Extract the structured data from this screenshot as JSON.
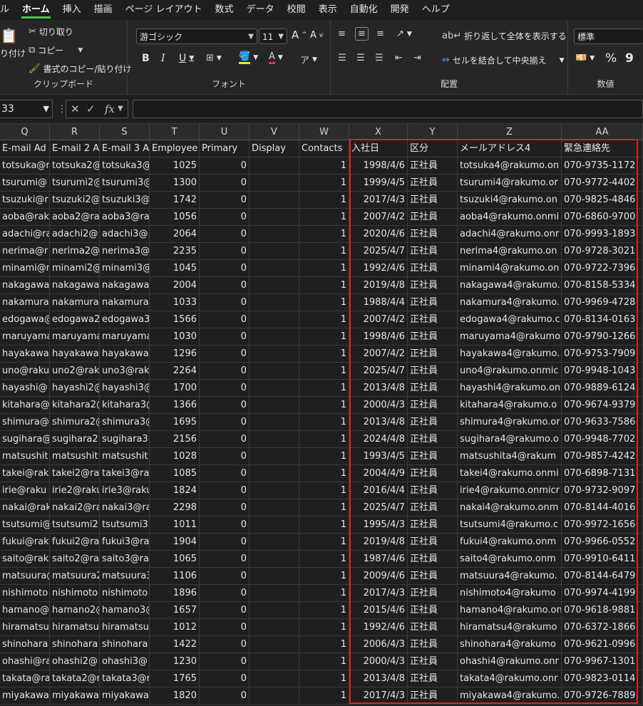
{
  "menu": [
    "ル",
    "ホーム",
    "挿入",
    "描画",
    "ページ レイアウト",
    "数式",
    "データ",
    "校閲",
    "表示",
    "自動化",
    "開発",
    "ヘルプ"
  ],
  "ribbon": {
    "clipboard": {
      "paste": "り付け",
      "cut": "切り取り",
      "copy": "コピー",
      "format_painter": "書式のコピー/貼り付け",
      "label": "クリップボード"
    },
    "font": {
      "family": "游ゴシック",
      "size": "11",
      "grow": "A",
      "shrink": "A",
      "bold": "B",
      "italic": "I",
      "underline": "U",
      "label": "フォント"
    },
    "alignment": {
      "wrap": "折り返して全体を表示する",
      "merge": "セルを結合して中央揃え",
      "label": "配置"
    },
    "number": {
      "format": "標準",
      "percent": "%",
      "comma": "9",
      "label": "数値"
    }
  },
  "formula": {
    "namebox": "33",
    "fx": "fx"
  },
  "columns": [
    "Q",
    "R",
    "S",
    "T",
    "U",
    "V",
    "W",
    "X",
    "Y",
    "Z",
    "AA"
  ],
  "headers": [
    "E-mail Ad",
    "E-mail 2 A",
    "E-mail 3 A",
    "Employee",
    "Primary",
    "Display",
    "Contacts",
    "入社日",
    "区分",
    "メールアドレス4",
    "緊急連絡先"
  ],
  "rows": [
    [
      "totsuka@r",
      "totsuka2@",
      "totsuka3@",
      "1025",
      "0",
      "",
      "1",
      "1998/4/6",
      "正社員",
      "totsuka4@rakumo.on",
      "070-9735-1172"
    ],
    [
      "tsurumi@",
      "tsurumi2@",
      "tsurumi3@",
      "1300",
      "0",
      "",
      "1",
      "1999/4/5",
      "正社員",
      "tsurumi4@rakumo.or",
      "070-9772-4402"
    ],
    [
      "tsuzuki@r",
      "tsuzuki2@",
      "tsuzuki3@",
      "1742",
      "0",
      "",
      "1",
      "2017/4/3",
      "正社員",
      "tsuzuki4@rakumo.on",
      "070-9825-4846"
    ],
    [
      "aoba@rak",
      "aoba2@ra",
      "aoba3@ra",
      "1056",
      "0",
      "",
      "1",
      "2007/4/2",
      "正社員",
      "aoba4@rakumo.onmi",
      "070-6860-9700"
    ],
    [
      "adachi@ra",
      "adachi2@",
      "adachi3@",
      "2064",
      "0",
      "",
      "1",
      "2020/4/6",
      "正社員",
      "adachi4@rakumo.onr",
      "070-9993-1893"
    ],
    [
      "nerima@r",
      "nerima2@",
      "nerima3@",
      "2235",
      "0",
      "",
      "1",
      "2025/4/7",
      "正社員",
      "nerima4@rakumo.on",
      "070-9728-3021"
    ],
    [
      "minami@r",
      "minami2@",
      "minami3@",
      "1045",
      "0",
      "",
      "1",
      "1992/4/6",
      "正社員",
      "minami4@rakumo.on",
      "070-9722-7396"
    ],
    [
      "nakagawa",
      "nakagawa",
      "nakagawa",
      "2004",
      "0",
      "",
      "1",
      "2019/4/8",
      "正社員",
      "nakagawa4@rakumo.",
      "070-8158-5334"
    ],
    [
      "nakamura",
      "nakamura",
      "nakamura",
      "1033",
      "0",
      "",
      "1",
      "1988/4/4",
      "正社員",
      "nakamura4@rakumo.",
      "070-9969-4728"
    ],
    [
      "edogawa@",
      "edogawa2",
      "edogawa3",
      "1566",
      "0",
      "",
      "1",
      "2007/4/2",
      "正社員",
      "edogawa4@rakumo.c",
      "070-8134-0163"
    ],
    [
      "maruyama",
      "maruyama",
      "maruyama",
      "1030",
      "0",
      "",
      "1",
      "1998/4/6",
      "正社員",
      "maruyama4@rakumo",
      "070-9790-1266"
    ],
    [
      "hayakawa",
      "hayakawa",
      "hayakawa",
      "1296",
      "0",
      "",
      "1",
      "2007/4/2",
      "正社員",
      "hayakawa4@rakumo.",
      "070-9753-7909"
    ],
    [
      "uno@raku",
      "uno2@rak",
      "uno3@rak",
      "2264",
      "0",
      "",
      "1",
      "2025/4/7",
      "正社員",
      "uno4@rakumo.onmic",
      "070-9948-1043"
    ],
    [
      "hayashi@",
      "hayashi2@",
      "hayashi3@",
      "1700",
      "0",
      "",
      "1",
      "2013/4/8",
      "正社員",
      "hayashi4@rakumo.on",
      "070-9889-6124"
    ],
    [
      "kitahara@",
      "kitahara2@",
      "kitahara3@",
      "1366",
      "0",
      "",
      "1",
      "2000/4/3",
      "正社員",
      "kitahara4@rakumo.o",
      "070-9674-9379"
    ],
    [
      "shimura@",
      "shimura2@",
      "shimura3@",
      "1695",
      "0",
      "",
      "1",
      "2013/4/8",
      "正社員",
      "shimura4@rakumo.or",
      "070-9633-7586"
    ],
    [
      "sugihara@",
      "sugihara2",
      "sugihara3",
      "2156",
      "0",
      "",
      "1",
      "2024/4/8",
      "正社員",
      "sugihara4@rakumo.o",
      "070-9948-7702"
    ],
    [
      "matsushit",
      "matsushit",
      "matsushit",
      "1028",
      "0",
      "",
      "1",
      "1993/4/5",
      "正社員",
      "matsushita4@rakum",
      "070-9857-4242"
    ],
    [
      "takei@rak",
      "takei2@ra",
      "takei3@ra",
      "1085",
      "0",
      "",
      "1",
      "2004/4/9",
      "正社員",
      "takei4@rakumo.onmi",
      "070-6898-7131"
    ],
    [
      "irie@raku",
      "irie2@raku",
      "irie3@raku",
      "1824",
      "0",
      "",
      "1",
      "2016/4/4",
      "正社員",
      "irie4@rakumo.onmicr",
      "070-9732-9097"
    ],
    [
      "nakai@rak",
      "nakai2@ra",
      "nakai3@ra",
      "2298",
      "0",
      "",
      "1",
      "2025/4/7",
      "正社員",
      "nakai4@rakumo.onm",
      "070-8144-4016"
    ],
    [
      "tsutsumi@",
      "tsutsumi2",
      "tsutsumi3",
      "1011",
      "0",
      "",
      "1",
      "1995/4/3",
      "正社員",
      "tsutsumi4@rakumo.c",
      "070-9972-1656"
    ],
    [
      "fukui@rak",
      "fukui2@ra",
      "fukui3@ra",
      "1904",
      "0",
      "",
      "1",
      "2019/4/8",
      "正社員",
      "fukui4@rakumo.onm",
      "070-9966-0552"
    ],
    [
      "saito@rak",
      "saito2@ra",
      "saito3@ra",
      "1065",
      "0",
      "",
      "1",
      "1987/4/6",
      "正社員",
      "saito4@rakumo.onm",
      "070-9910-6411"
    ],
    [
      "matsuura@",
      "matsuura2",
      "matsuura3",
      "1106",
      "0",
      "",
      "1",
      "2009/4/6",
      "正社員",
      "matsuura4@rakumo.",
      "070-8144-6479"
    ],
    [
      "nishimoto",
      "nishimoto",
      "nishimoto",
      "1896",
      "0",
      "",
      "1",
      "2017/4/3",
      "正社員",
      "nishimoto4@rakumo",
      "070-9974-4199"
    ],
    [
      "hamano@",
      "hamano2@",
      "hamano3@",
      "1657",
      "0",
      "",
      "1",
      "2015/4/6",
      "正社員",
      "hamano4@rakumo.on",
      "070-9618-9881"
    ],
    [
      "hiramatsu",
      "hiramatsu",
      "hiramatsu",
      "1012",
      "0",
      "",
      "1",
      "1992/4/6",
      "正社員",
      "hiramatsu4@rakumo",
      "070-6372-1866"
    ],
    [
      "shinohara",
      "shinohara",
      "shinohara",
      "1422",
      "0",
      "",
      "1",
      "2006/4/3",
      "正社員",
      "shinohara4@rakumo",
      "070-9621-0996"
    ],
    [
      "ohashi@ra",
      "ohashi2@",
      "ohashi3@",
      "1230",
      "0",
      "",
      "1",
      "2000/4/3",
      "正社員",
      "ohashi4@rakumo.onr",
      "070-9967-1301"
    ],
    [
      "takata@ra",
      "takata2@r",
      "takata3@r",
      "1765",
      "0",
      "",
      "1",
      "2013/4/8",
      "正社員",
      "takata4@rakumo.onr",
      "070-9823-0114"
    ],
    [
      "miyakawa",
      "miyakawa",
      "miyakawa",
      "1820",
      "0",
      "",
      "1",
      "2017/4/3",
      "正社員",
      "miyakawa4@rakumo.",
      "070-9726-7889"
    ]
  ]
}
